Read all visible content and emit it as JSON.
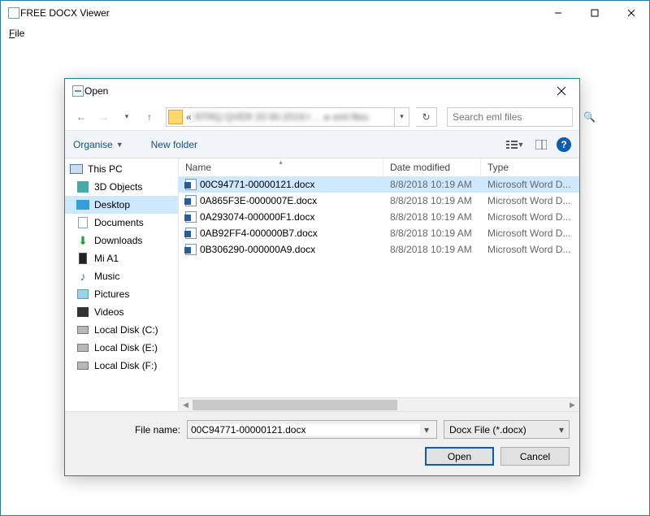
{
  "app": {
    "title": "FREE DOCX Viewer",
    "menu": {
      "file": "File"
    }
  },
  "dialog": {
    "title": "Open",
    "search_placeholder": "Search eml files",
    "toolbar": {
      "organise": "Organise",
      "newfolder": "New folder",
      "help_symbol": "?"
    },
    "sidebar": {
      "root": "This PC",
      "items": [
        {
          "label": "3D Objects"
        },
        {
          "label": "Desktop"
        },
        {
          "label": "Documents"
        },
        {
          "label": "Downloads"
        },
        {
          "label": "Mi A1"
        },
        {
          "label": "Music"
        },
        {
          "label": "Pictures"
        },
        {
          "label": "Videos"
        },
        {
          "label": "Local Disk (C:)"
        },
        {
          "label": "Local Disk (E:)"
        },
        {
          "label": "Local Disk (F:)"
        }
      ],
      "selected_index": 1
    },
    "columns": {
      "name": "Name",
      "date": "Date modified",
      "type": "Type"
    },
    "files": [
      {
        "name": "00C94771-00000121.docx",
        "date": "8/8/2018 10:19 AM",
        "type": "Microsoft Word D..."
      },
      {
        "name": "0A865F3E-0000007E.docx",
        "date": "8/8/2018 10:19 AM",
        "type": "Microsoft Word D..."
      },
      {
        "name": "0A293074-000000F1.docx",
        "date": "8/8/2018 10:19 AM",
        "type": "Microsoft Word D..."
      },
      {
        "name": "0AB92FF4-000000B7.docx",
        "date": "8/8/2018 10:19 AM",
        "type": "Microsoft Word D..."
      },
      {
        "name": "0B306290-000000A9.docx",
        "date": "8/8/2018 10:19 AM",
        "type": "Microsoft Word D..."
      }
    ],
    "selected_file_index": 0,
    "filename_label": "File name:",
    "filename_value": "00C94771-00000121.docx",
    "filter_value": "Docx File (*.docx)",
    "open_btn": "Open",
    "cancel_btn": "Cancel"
  }
}
